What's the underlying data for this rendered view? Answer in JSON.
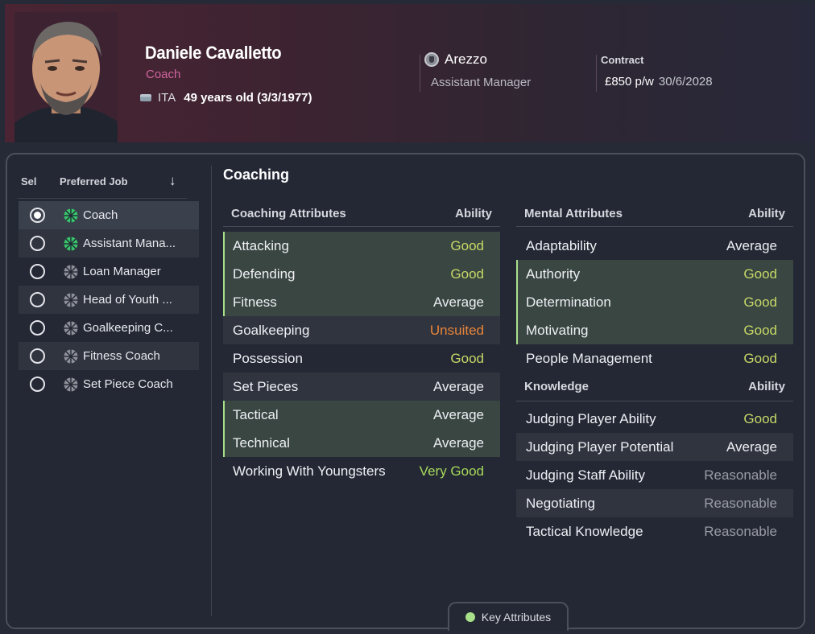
{
  "header": {
    "name": "Daniele Cavalletto",
    "role": "Coach",
    "nationality": "ITA",
    "age": "49 years old (3/3/1977)",
    "club": "Arezzo",
    "club_role": "Assistant Manager",
    "contract_label": "Contract",
    "wage": "£850 p/w",
    "contract_expiry": "30/6/2028"
  },
  "jobs": {
    "col_sel": "Sel",
    "col_job": "Preferred Job",
    "items": [
      {
        "label": "Coach",
        "selected": true,
        "icon": "green"
      },
      {
        "label": "Assistant Mana...",
        "selected": false,
        "icon": "green"
      },
      {
        "label": "Loan Manager",
        "selected": false,
        "icon": "grey"
      },
      {
        "label": "Head of Youth ...",
        "selected": false,
        "icon": "grey"
      },
      {
        "label": "Goalkeeping C...",
        "selected": false,
        "icon": "grey"
      },
      {
        "label": "Fitness Coach",
        "selected": false,
        "icon": "grey"
      },
      {
        "label": "Set Piece Coach",
        "selected": false,
        "icon": "grey"
      }
    ]
  },
  "main": {
    "title": "Coaching",
    "coaching": {
      "heading": "Coaching Attributes",
      "ability_heading": "Ability",
      "rows": [
        {
          "name": "Attacking",
          "value": "Good",
          "key": true
        },
        {
          "name": "Defending",
          "value": "Good",
          "key": true
        },
        {
          "name": "Fitness",
          "value": "Average",
          "key": true
        },
        {
          "name": "Goalkeeping",
          "value": "Unsuited",
          "key": false
        },
        {
          "name": "Possession",
          "value": "Good",
          "key": false
        },
        {
          "name": "Set Pieces",
          "value": "Average",
          "key": false
        },
        {
          "name": "Tactical",
          "value": "Average",
          "key": true
        },
        {
          "name": "Technical",
          "value": "Average",
          "key": true
        },
        {
          "name": "Working With Youngsters",
          "value": "Very Good",
          "key": false
        }
      ]
    },
    "mental": {
      "heading": "Mental Attributes",
      "ability_heading": "Ability",
      "rows": [
        {
          "name": "Adaptability",
          "value": "Average",
          "key": false
        },
        {
          "name": "Authority",
          "value": "Good",
          "key": true
        },
        {
          "name": "Determination",
          "value": "Good",
          "key": true
        },
        {
          "name": "Motivating",
          "value": "Good",
          "key": true
        },
        {
          "name": "People Management",
          "value": "Good",
          "key": false
        }
      ]
    },
    "knowledge": {
      "heading": "Knowledge",
      "ability_heading": "Ability",
      "rows": [
        {
          "name": "Judging Player Ability",
          "value": "Good",
          "key": false
        },
        {
          "name": "Judging Player Potential",
          "value": "Average",
          "key": false
        },
        {
          "name": "Judging Staff Ability",
          "value": "Reasonable",
          "key": false
        },
        {
          "name": "Negotiating",
          "value": "Reasonable",
          "key": false
        },
        {
          "name": "Tactical Knowledge",
          "value": "Reasonable",
          "key": false
        }
      ]
    }
  },
  "key_attributes_label": "Key Attributes",
  "colors": {
    "key_marker": "#a8e08a",
    "good": "#c7d866",
    "very_good": "#a7d85a",
    "unsuited": "#e8853a",
    "reasonable": "#9a9da6",
    "role": "#d0649e"
  }
}
